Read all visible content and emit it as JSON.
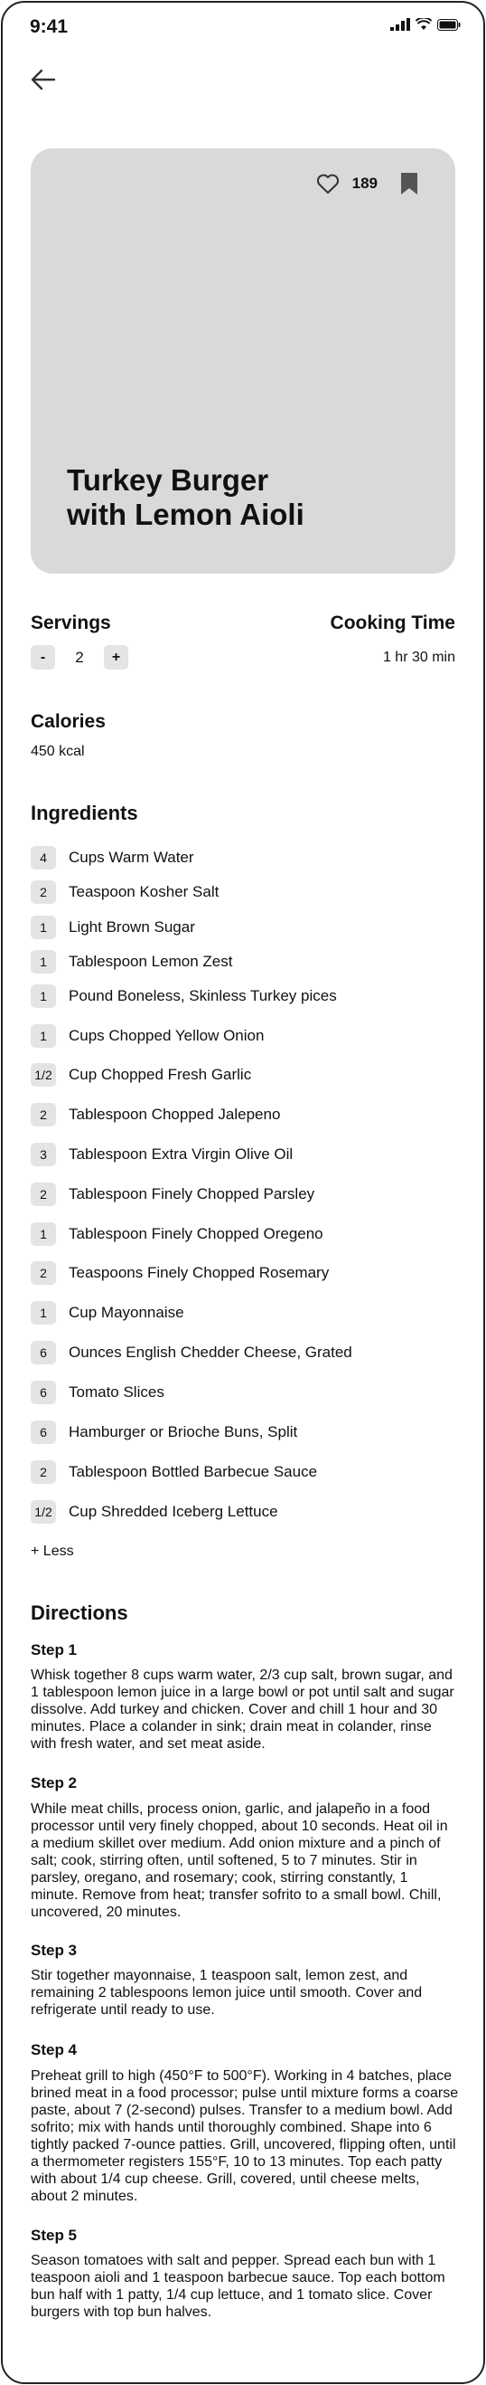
{
  "status_bar": {
    "time": "9:41"
  },
  "recipe": {
    "title_line1": "Turkey Burger",
    "title_line2": "with Lemon Aioli",
    "likes": "189"
  },
  "servings": {
    "label": "Servings",
    "minus": "-",
    "plus": "+",
    "value": "2"
  },
  "cooking_time": {
    "label": "Cooking Time",
    "value": "1 hr 30 min"
  },
  "calories": {
    "label": "Calories",
    "value": "450 kcal"
  },
  "ingredients": {
    "label": "Ingredients",
    "less_label": "+ Less",
    "items": [
      {
        "qty": "4",
        "name": "Cups Warm Water"
      },
      {
        "qty": "2",
        "name": "Teaspoon Kosher Salt"
      },
      {
        "qty": "1",
        "name": "Light Brown Sugar"
      },
      {
        "qty": "1",
        "name": "Tablespoon Lemon Zest"
      },
      {
        "qty": "1",
        "name": "Pound Boneless, Skinless Turkey pices"
      },
      {
        "qty": "1",
        "name": "Cups Chopped Yellow Onion"
      },
      {
        "qty": "1/2",
        "name": "Cup Chopped Fresh Garlic"
      },
      {
        "qty": "2",
        "name": "Tablespoon Chopped Jalepeno"
      },
      {
        "qty": "3",
        "name": "Tablespoon Extra Virgin Olive Oil"
      },
      {
        "qty": "2",
        "name": "Tablespoon Finely Chopped Parsley"
      },
      {
        "qty": "1",
        "name": "Tablespoon Finely Chopped Oregeno"
      },
      {
        "qty": "2",
        "name": "Teaspoons Finely Chopped Rosemary"
      },
      {
        "qty": "1",
        "name": "Cup Mayonnaise"
      },
      {
        "qty": "6",
        "name": "Ounces English Chedder Cheese, Grated"
      },
      {
        "qty": "6",
        "name": "Tomato Slices"
      },
      {
        "qty": "6",
        "name": "Hamburger or Brioche Buns, Split"
      },
      {
        "qty": "2",
        "name": "Tablespoon Bottled Barbecue Sauce"
      },
      {
        "qty": "1/2",
        "name": "Cup Shredded Iceberg Lettuce"
      }
    ]
  },
  "directions": {
    "label": "Directions",
    "steps": [
      {
        "title": "Step 1",
        "text": "Whisk together 8 cups warm water, 2/3 cup salt, brown sugar, and 1 tablespoon lemon juice in a large bowl or pot until salt and sugar dissolve. Add turkey and chicken. Cover and chill 1 hour and 30 minutes. Place a colander in sink; drain meat in colander, rinse with fresh water, and set meat aside."
      },
      {
        "title": "Step 2",
        "text": "While meat chills, process onion, garlic, and jalapeño in a food processor until very finely chopped, about 10 seconds. Heat oil in a medium skillet over medium. Add onion mixture and a pinch of salt; cook, stirring often, until softened, 5 to 7 minutes. Stir in parsley, oregano, and rosemary; cook, stirring constantly, 1 minute. Remove from heat; transfer sofrito to a small bowl. Chill, uncovered, 20 minutes."
      },
      {
        "title": "Step 3",
        "text": "Stir together mayonnaise, 1 teaspoon salt, lemon zest, and remaining 2 tablespoons lemon juice until smooth. Cover and refrigerate until ready to use."
      },
      {
        "title": "Step 4",
        "text": "Preheat grill to high (450°F to 500°F). Working in 4 batches, place brined meat in a food processor; pulse until mixture forms a coarse paste, about 7 (2-second) pulses. Transfer to a medium bowl. Add sofrito; mix with hands until thoroughly combined. Shape into 6 tightly packed 7-ounce patties. Grill, uncovered, flipping often, until a thermometer registers 155°F, 10 to 13 minutes. Top each patty with about 1/4 cup cheese. Grill, covered, until cheese melts, about 2 minutes."
      },
      {
        "title": "Step 5",
        "text": "Season tomatoes with salt and pepper. Spread each bun with 1 teaspoon aioli and 1 teaspoon barbecue sauce. Top each bottom bun half with 1 patty, 1/4 cup lettuce, and 1 tomato slice. Cover burgers with top bun halves."
      }
    ]
  }
}
